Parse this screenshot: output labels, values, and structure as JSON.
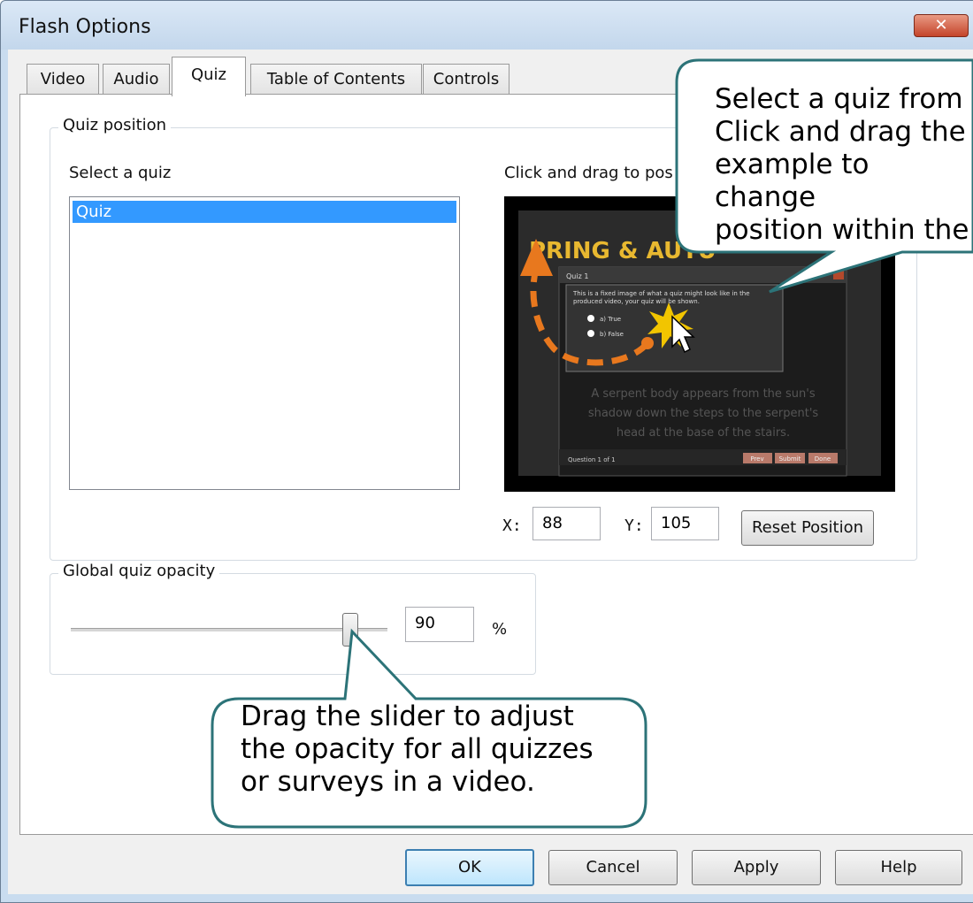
{
  "window": {
    "title": "Flash Options",
    "close_label": "✕"
  },
  "tabs": [
    {
      "label": "Video",
      "active": false
    },
    {
      "label": "Audio",
      "active": false
    },
    {
      "label": "Quiz",
      "active": true
    },
    {
      "label": "Table of Contents",
      "active": false
    },
    {
      "label": "Controls",
      "active": false
    }
  ],
  "quiz_position": {
    "group_label": "Quiz position",
    "select_label": "Select a quiz",
    "list_items": [
      "Quiz"
    ],
    "selected_item": "Quiz",
    "preview_label": "Click and drag to pos",
    "x_label": "X:",
    "x_value": "88",
    "y_label": "Y:",
    "y_value": "105",
    "reset_label": "Reset Position"
  },
  "preview": {
    "title_text": "PRING & AUTU",
    "quiz_title": "Quiz 1",
    "quiz_body": "This is a fixed image of what a quiz might look like in the produced video, your quiz will be shown.",
    "option_a": "a) True",
    "option_b": "b) False",
    "caption_line1": "A serpent body appears from the sun's",
    "caption_line2": "shadow down the steps to the serpent's",
    "caption_line3": "head at the base of the stairs.",
    "footer_left": "Question 1 of 1",
    "btn_prev": "Prev",
    "btn_submit": "Submit",
    "btn_done": "Done"
  },
  "opacity": {
    "group_label": "Global quiz opacity",
    "value": "90",
    "unit": "%",
    "level_percent": 90
  },
  "callouts": {
    "top_right": [
      "Select a quiz from",
      "Click and drag the",
      "example to change",
      "position within the"
    ],
    "bottom": [
      "Drag the slider to adjust",
      "the opacity for all quizzes",
      "or surveys in a video."
    ]
  },
  "footer_buttons": {
    "ok": "OK",
    "cancel": "Cancel",
    "apply": "Apply",
    "help": "Help"
  },
  "colors": {
    "selection": "#3399ff",
    "callout_border": "#2c7378",
    "arrow": "#e8781e",
    "starburst": "#f2c500"
  }
}
